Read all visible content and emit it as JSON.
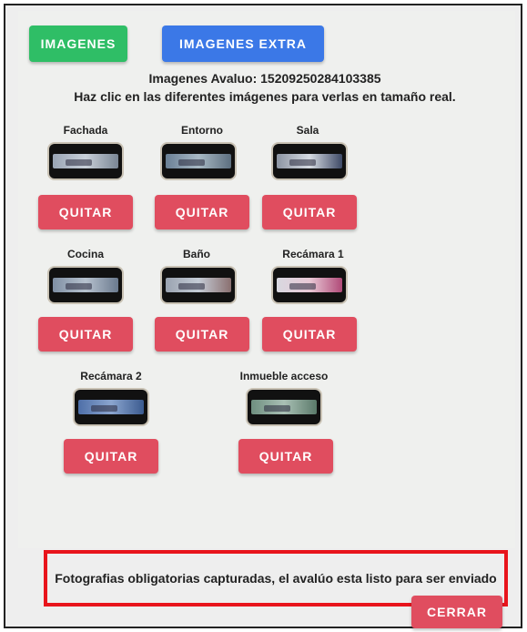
{
  "buttons": {
    "imagenes": "IMAGENES",
    "imagenes_extra": "IMAGENES EXTRA"
  },
  "info": {
    "avaluo_line": "Imagenes Avaluo: 15209250284103385",
    "instruction": "Haz clic en las diferentes imágenes para verlas en tamaño real."
  },
  "photos": [
    {
      "label": "Fachada",
      "remove_label": "QUITAR"
    },
    {
      "label": "Entorno",
      "remove_label": "QUITAR"
    },
    {
      "label": "Sala",
      "remove_label": "QUITAR"
    },
    {
      "label": "Cocina",
      "remove_label": "QUITAR"
    },
    {
      "label": "Baño",
      "remove_label": "QUITAR"
    },
    {
      "label": "Recámara 1",
      "remove_label": "QUITAR"
    },
    {
      "label": "Recámara 2",
      "remove_label": "QUITAR"
    },
    {
      "label": "Inmueble acceso",
      "remove_label": "QUITAR"
    }
  ],
  "status_message": "Fotografias obligatorias capturadas, el avalúo esta listo para ser enviado",
  "close_label": "CERRAR",
  "colors": {
    "green": "#2fbe66",
    "blue": "#3b78e7",
    "red_button": "#e04d5f",
    "highlight_border": "#e8141c"
  }
}
